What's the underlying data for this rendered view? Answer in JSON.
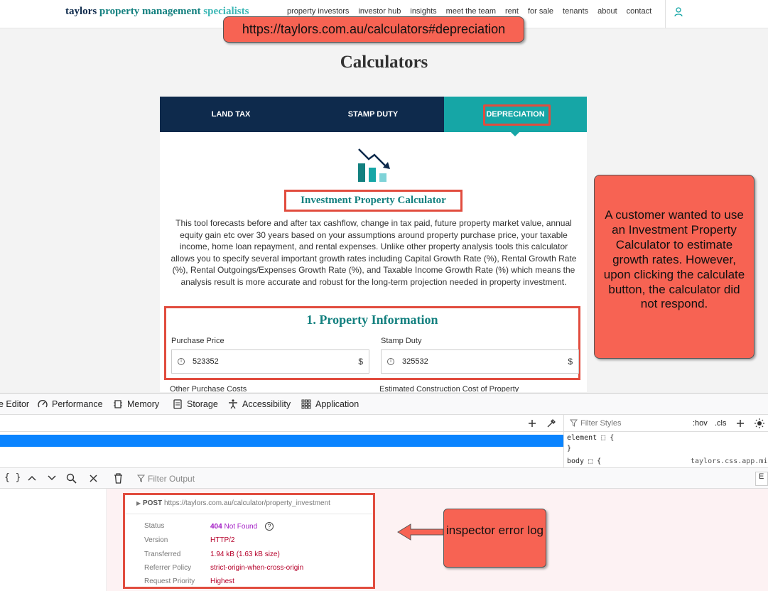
{
  "nav": {
    "logo_part1": "taylors",
    "logo_part2": "property management",
    "logo_part3": "specialists",
    "links": [
      "property investors",
      "investor hub",
      "insights",
      "meet the team",
      "rent",
      "for sale",
      "tenants",
      "about",
      "contact"
    ],
    "user_icon": "user-icon"
  },
  "url_callout": "https://taylors.com.au/calculators#depreciation",
  "page_title": "Calculators",
  "calculator": {
    "tabs": [
      "LAND TAX",
      "STAMP DUTY",
      "DEPRECIATION"
    ],
    "active_tab": "DEPRECIATION",
    "icon": "chart-down-icon",
    "title": "Investment Property Calculator",
    "description": "This tool forecasts before and after tax cashflow, change in tax paid, future property market value, annual equity gain etc over 30 years based on your assumptions around property purchase price, your taxable income, home loan repayment, and rental expenses. Unlike other property analysis tools this calculator allows you to specify several important growth rates including Capital Growth Rate (%), Rental Growth Rate (%), Rental Outgoings/Expenses Growth Rate (%), and Taxable Income Growth Rate (%) which means the analysis result is more accurate and robust for the long-term projection needed in property investment.",
    "section_title": "1. Property Information",
    "fields": [
      {
        "label": "Purchase Price",
        "value": "523352",
        "unit": "$"
      },
      {
        "label": "Stamp Duty",
        "value": "325532",
        "unit": "$"
      }
    ],
    "next_labels": [
      "Other Purchase Costs",
      "Estimated Construction Cost of Property"
    ]
  },
  "note_callout": "A customer wanted to use an Investment Property Calculator to estimate growth rates. However, upon clicking the calculate button, the calculator did not respond.",
  "devtools": {
    "tabs": [
      "e Editor",
      "Performance",
      "Memory",
      "Storage",
      "Accessibility",
      "Application"
    ],
    "filter_styles": "Filter Styles",
    "hov": ":hov",
    "cls": ".cls",
    "styles_lines": [
      "element ⬚ {",
      "}",
      "body ⬚ {"
    ],
    "styles_source": "taylors.css.app.mi",
    "filter_output": "Filter Output",
    "console_right": "E",
    "request": {
      "method": "POST",
      "url": "https://taylors.com.au/calculator/property_investment",
      "rows": [
        {
          "key": "Status",
          "code": "404",
          "value": "Not Found"
        },
        {
          "key": "Version",
          "value": "HTTP/2"
        },
        {
          "key": "Transferred",
          "value": "1.94 kB (1.63 kB size)"
        },
        {
          "key": "Referrer Policy",
          "value": "strict-origin-when-cross-origin"
        },
        {
          "key": "Request Priority",
          "value": "Highest"
        }
      ]
    }
  },
  "inspector_callout": "inspector error log",
  "colors": {
    "navy": "#0e2a4c",
    "teal": "#16a6a6",
    "callout": "#f76353",
    "highlight": "#e14c3e",
    "selection": "#0a84ff"
  }
}
